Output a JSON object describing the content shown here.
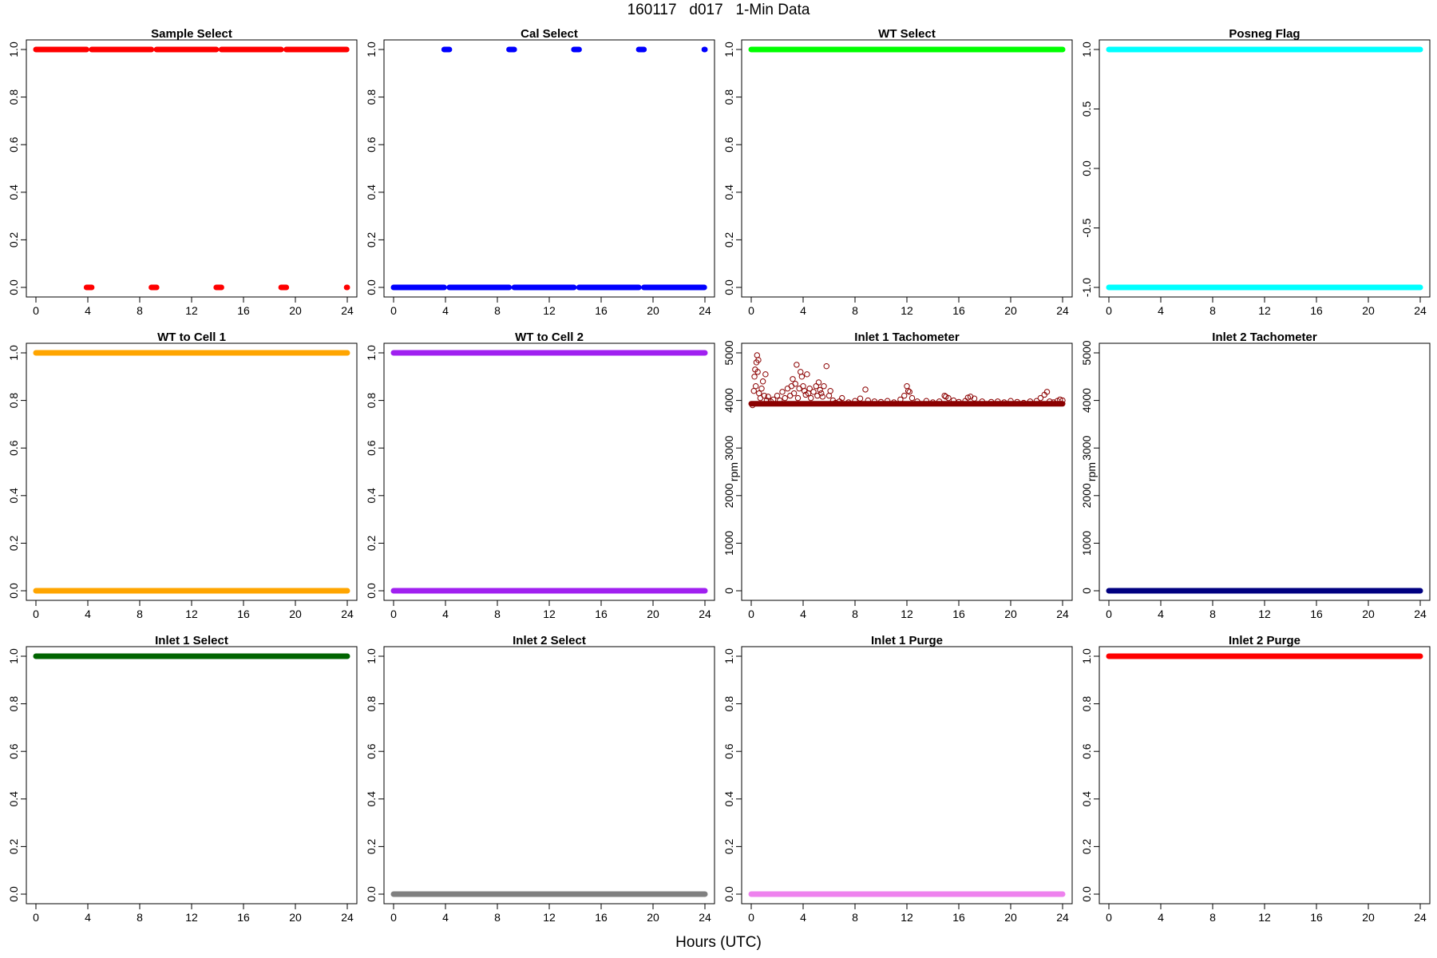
{
  "figure": {
    "title": "160117   d017   1-Min Data",
    "xlabel": "Hours (UTC)"
  },
  "chart_data": [
    {
      "type": "scatter",
      "title": "Sample Select",
      "color": "#ff0000",
      "xlim": [
        0,
        24
      ],
      "ylim": [
        0,
        1
      ],
      "xticks": [
        0,
        4,
        8,
        12,
        16,
        20,
        24
      ],
      "yticks": [
        "0.0",
        "0.2",
        "0.4",
        "0.6",
        "0.8",
        "1.0"
      ],
      "ylabel": "",
      "segments": [
        {
          "y": 1,
          "x": [
            0,
            3.9
          ]
        },
        {
          "y": 1,
          "x": [
            4.3,
            8.9
          ]
        },
        {
          "y": 1,
          "x": [
            9.3,
            13.9
          ]
        },
        {
          "y": 1,
          "x": [
            14.3,
            18.9
          ]
        },
        {
          "y": 1,
          "x": [
            19.3,
            23.95
          ]
        },
        {
          "y": 0,
          "x": [
            3.9,
            4.3
          ]
        },
        {
          "y": 0,
          "x": [
            8.9,
            9.3
          ]
        },
        {
          "y": 0,
          "x": [
            13.9,
            14.3
          ]
        },
        {
          "y": 0,
          "x": [
            18.9,
            19.3
          ]
        },
        {
          "y": 0,
          "x": [
            23.95,
            24
          ]
        }
      ]
    },
    {
      "type": "scatter",
      "title": "Cal Select",
      "color": "#0000ff",
      "xlim": [
        0,
        24
      ],
      "ylim": [
        0,
        1
      ],
      "xticks": [
        0,
        4,
        8,
        12,
        16,
        20,
        24
      ],
      "yticks": [
        "0.0",
        "0.2",
        "0.4",
        "0.6",
        "0.8",
        "1.0"
      ],
      "ylabel": "",
      "segments": [
        {
          "y": 0,
          "x": [
            0,
            3.9
          ]
        },
        {
          "y": 0,
          "x": [
            4.3,
            8.9
          ]
        },
        {
          "y": 0,
          "x": [
            9.3,
            13.9
          ]
        },
        {
          "y": 0,
          "x": [
            14.3,
            18.9
          ]
        },
        {
          "y": 0,
          "x": [
            19.3,
            23.95
          ]
        },
        {
          "y": 1,
          "x": [
            3.9,
            4.3
          ]
        },
        {
          "y": 1,
          "x": [
            8.9,
            9.3
          ]
        },
        {
          "y": 1,
          "x": [
            13.9,
            14.3
          ]
        },
        {
          "y": 1,
          "x": [
            18.9,
            19.3
          ]
        },
        {
          "y": 1,
          "x": [
            23.95,
            24
          ]
        }
      ]
    },
    {
      "type": "scatter",
      "title": "WT Select",
      "color": "#00ff00",
      "xlim": [
        0,
        24
      ],
      "ylim": [
        0,
        1
      ],
      "xticks": [
        0,
        4,
        8,
        12,
        16,
        20,
        24
      ],
      "yticks": [
        "0.0",
        "0.2",
        "0.4",
        "0.6",
        "0.8",
        "1.0"
      ],
      "ylabel": "",
      "segments": [
        {
          "y": 1,
          "x": [
            0,
            24
          ]
        }
      ]
    },
    {
      "type": "scatter",
      "title": "Posneg Flag",
      "color": "#00ffff",
      "xlim": [
        0,
        24
      ],
      "ylim": [
        -1,
        1
      ],
      "xticks": [
        0,
        4,
        8,
        12,
        16,
        20,
        24
      ],
      "yticks": [
        "-1.0",
        "-0.5",
        "0.0",
        "0.5",
        "1.0"
      ],
      "ylabel": "",
      "segments": [
        {
          "y": 1,
          "x": [
            0,
            24
          ]
        },
        {
          "y": -1,
          "x": [
            0,
            24
          ]
        }
      ]
    },
    {
      "type": "scatter",
      "title": "WT to Cell 1",
      "color": "#ffa500",
      "xlim": [
        0,
        24
      ],
      "ylim": [
        0,
        1
      ],
      "xticks": [
        0,
        4,
        8,
        12,
        16,
        20,
        24
      ],
      "yticks": [
        "0.0",
        "0.2",
        "0.4",
        "0.6",
        "0.8",
        "1.0"
      ],
      "ylabel": "",
      "segments": [
        {
          "y": 1,
          "x": [
            0,
            24
          ]
        },
        {
          "y": 0,
          "x": [
            0,
            24
          ]
        }
      ]
    },
    {
      "type": "scatter",
      "title": "WT to Cell 2",
      "color": "#a020f0",
      "xlim": [
        0,
        24
      ],
      "ylim": [
        0,
        1
      ],
      "xticks": [
        0,
        4,
        8,
        12,
        16,
        20,
        24
      ],
      "yticks": [
        "0.0",
        "0.2",
        "0.4",
        "0.6",
        "0.8",
        "1.0"
      ],
      "ylabel": "",
      "segments": [
        {
          "y": 1,
          "x": [
            0,
            24
          ]
        },
        {
          "y": 0,
          "x": [
            0,
            24
          ]
        }
      ]
    },
    {
      "type": "scatter",
      "title": "Inlet 1 Tachometer",
      "color": "#8b0000",
      "xlim": [
        0,
        24
      ],
      "ylim": [
        0,
        5000
      ],
      "xticks": [
        0,
        4,
        8,
        12,
        16,
        20,
        24
      ],
      "yticks": [
        "0",
        "1000",
        "2000",
        "3000",
        "4000",
        "5000"
      ],
      "ylabel": "rpm",
      "segments": [
        {
          "y": 3930,
          "x": [
            0,
            24
          ]
        }
      ],
      "points": [
        [
          0.1,
          3900
        ],
        [
          0.2,
          4200
        ],
        [
          0.25,
          4500
        ],
        [
          0.3,
          4650
        ],
        [
          0.35,
          4300
        ],
        [
          0.4,
          4800
        ],
        [
          0.45,
          4950
        ],
        [
          0.5,
          4600
        ],
        [
          0.55,
          4850
        ],
        [
          0.6,
          4150
        ],
        [
          0.7,
          4050
        ],
        [
          0.8,
          4250
        ],
        [
          0.9,
          4400
        ],
        [
          1.0,
          4100
        ],
        [
          1.1,
          4550
        ],
        [
          1.2,
          4000
        ],
        [
          1.3,
          4080
        ],
        [
          1.5,
          3980
        ],
        [
          1.7,
          4020
        ],
        [
          2.0,
          4100
        ],
        [
          2.2,
          4000
        ],
        [
          2.4,
          4180
        ],
        [
          2.6,
          4050
        ],
        [
          2.8,
          4250
        ],
        [
          3.0,
          4100
        ],
        [
          3.1,
          4300
        ],
        [
          3.2,
          4450
        ],
        [
          3.3,
          4150
        ],
        [
          3.4,
          4350
        ],
        [
          3.5,
          4750
        ],
        [
          3.6,
          4050
        ],
        [
          3.7,
          4250
        ],
        [
          3.8,
          4600
        ],
        [
          3.9,
          4500
        ],
        [
          4.0,
          4300
        ],
        [
          4.1,
          4200
        ],
        [
          4.2,
          4120
        ],
        [
          4.3,
          4550
        ],
        [
          4.4,
          4150
        ],
        [
          4.5,
          4250
        ],
        [
          4.6,
          4050
        ],
        [
          4.8,
          4180
        ],
        [
          5.0,
          4300
        ],
        [
          5.1,
          4100
        ],
        [
          5.2,
          4380
        ],
        [
          5.3,
          4220
        ],
        [
          5.4,
          4150
        ],
        [
          5.5,
          4080
        ],
        [
          5.6,
          4300
        ],
        [
          5.8,
          4720
        ],
        [
          6.0,
          4100
        ],
        [
          6.1,
          4200
        ],
        [
          6.3,
          4000
        ],
        [
          6.5,
          3950
        ],
        [
          6.8,
          3980
        ],
        [
          7.0,
          4050
        ],
        [
          7.5,
          3960
        ],
        [
          8.0,
          3990
        ],
        [
          8.4,
          4040
        ],
        [
          8.8,
          4230
        ],
        [
          9.0,
          4000
        ],
        [
          9.5,
          3980
        ],
        [
          10.0,
          3970
        ],
        [
          10.5,
          3990
        ],
        [
          11.0,
          3960
        ],
        [
          11.5,
          4020
        ],
        [
          11.8,
          4100
        ],
        [
          12.0,
          4300
        ],
        [
          12.1,
          4200
        ],
        [
          12.2,
          4180
        ],
        [
          12.4,
          4050
        ],
        [
          12.8,
          3980
        ],
        [
          13.5,
          3990
        ],
        [
          14.0,
          3960
        ],
        [
          14.5,
          3980
        ],
        [
          14.9,
          4100
        ],
        [
          15.0,
          4080
        ],
        [
          15.2,
          4050
        ],
        [
          15.6,
          4000
        ],
        [
          16.0,
          3970
        ],
        [
          16.5,
          3990
        ],
        [
          16.7,
          4060
        ],
        [
          16.9,
          4080
        ],
        [
          17.2,
          4040
        ],
        [
          17.8,
          3980
        ],
        [
          18.5,
          3970
        ],
        [
          19.0,
          3980
        ],
        [
          19.5,
          3960
        ],
        [
          20.0,
          3990
        ],
        [
          20.5,
          3970
        ],
        [
          21.0,
          3950
        ],
        [
          21.5,
          3980
        ],
        [
          22.0,
          3990
        ],
        [
          22.3,
          4050
        ],
        [
          22.6,
          4120
        ],
        [
          22.8,
          4180
        ],
        [
          23.0,
          3980
        ],
        [
          23.3,
          3960
        ],
        [
          23.6,
          3990
        ],
        [
          23.8,
          4020
        ],
        [
          24.0,
          4000
        ]
      ]
    },
    {
      "type": "scatter",
      "title": "Inlet 2 Tachometer",
      "color": "#000080",
      "xlim": [
        0,
        24
      ],
      "ylim": [
        0,
        5000
      ],
      "xticks": [
        0,
        4,
        8,
        12,
        16,
        20,
        24
      ],
      "yticks": [
        "0",
        "1000",
        "2000",
        "3000",
        "4000",
        "5000"
      ],
      "ylabel": "rpm",
      "segments": [
        {
          "y": 0,
          "x": [
            0,
            24
          ]
        }
      ]
    },
    {
      "type": "scatter",
      "title": "Inlet 1 Select",
      "color": "#006400",
      "xlim": [
        0,
        24
      ],
      "ylim": [
        0,
        1
      ],
      "xticks": [
        0,
        4,
        8,
        12,
        16,
        20,
        24
      ],
      "yticks": [
        "0.0",
        "0.2",
        "0.4",
        "0.6",
        "0.8",
        "1.0"
      ],
      "ylabel": "",
      "segments": [
        {
          "y": 1,
          "x": [
            0,
            24
          ]
        }
      ]
    },
    {
      "type": "scatter",
      "title": "Inlet 2 Select",
      "color": "#808080",
      "xlim": [
        0,
        24
      ],
      "ylim": [
        0,
        1
      ],
      "xticks": [
        0,
        4,
        8,
        12,
        16,
        20,
        24
      ],
      "yticks": [
        "0.0",
        "0.2",
        "0.4",
        "0.6",
        "0.8",
        "1.0"
      ],
      "ylabel": "",
      "segments": [
        {
          "y": 0,
          "x": [
            0,
            24
          ]
        }
      ]
    },
    {
      "type": "scatter",
      "title": "Inlet 1 Purge",
      "color": "#ee82ee",
      "xlim": [
        0,
        24
      ],
      "ylim": [
        0,
        1
      ],
      "xticks": [
        0,
        4,
        8,
        12,
        16,
        20,
        24
      ],
      "yticks": [
        "0.0",
        "0.2",
        "0.4",
        "0.6",
        "0.8",
        "1.0"
      ],
      "ylabel": "",
      "segments": [
        {
          "y": 0,
          "x": [
            0,
            24
          ]
        }
      ]
    },
    {
      "type": "scatter",
      "title": "Inlet 2 Purge",
      "color": "#ff0000",
      "xlim": [
        0,
        24
      ],
      "ylim": [
        0,
        1
      ],
      "xticks": [
        0,
        4,
        8,
        12,
        16,
        20,
        24
      ],
      "yticks": [
        "0.0",
        "0.2",
        "0.4",
        "0.6",
        "0.8",
        "1.0"
      ],
      "ylabel": "",
      "segments": [
        {
          "y": 1,
          "x": [
            0,
            24
          ]
        }
      ]
    }
  ]
}
